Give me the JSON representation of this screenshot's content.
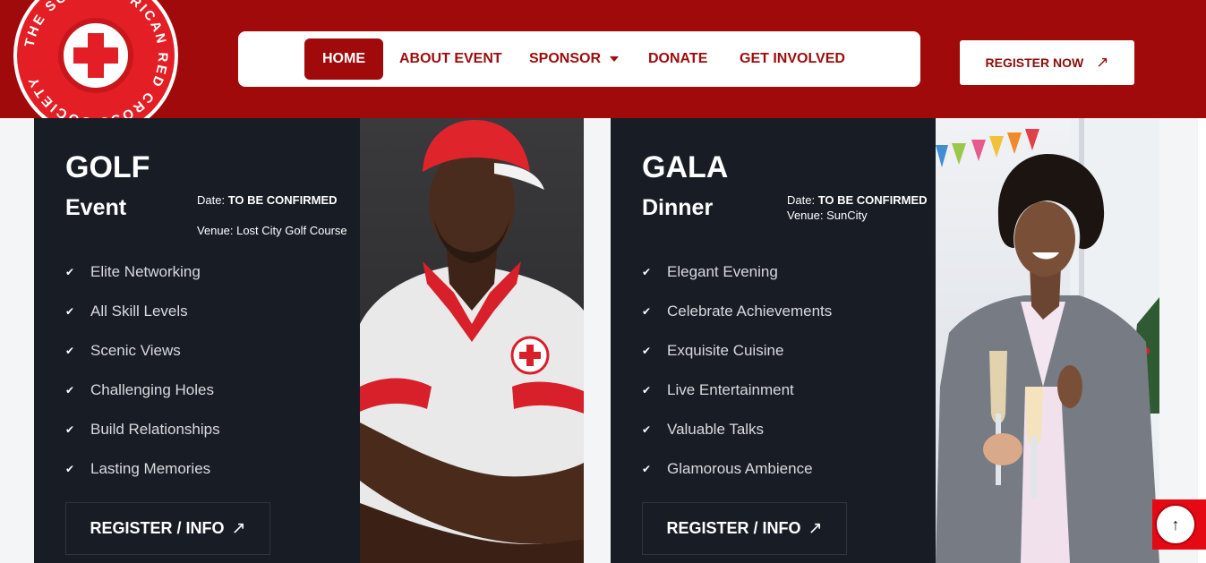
{
  "logo": {
    "text": "THE SOUTH AFRICAN RED CROSS SOCIETY"
  },
  "nav": {
    "items": [
      {
        "label": "HOME",
        "active": true
      },
      {
        "label": "ABOUT EVENT"
      },
      {
        "label": "SPONSOR"
      },
      {
        "label": "DONATE"
      },
      {
        "label": "GET INVOLVED"
      }
    ]
  },
  "header": {
    "register_label": "REGISTER NOW",
    "register_icon": "arrow-up-right-icon"
  },
  "golf": {
    "title": "GOLF",
    "subtitle": "Event",
    "date_label": "Date: ",
    "date_value": "TO BE CONFIRMED",
    "venue": "Venue: Lost City Golf Course",
    "features": [
      "Elite Networking",
      "All Skill Levels",
      "Scenic Views",
      "Challenging Holes",
      "Build Relationships",
      "Lasting Memories"
    ],
    "button_label": "REGISTER / INFO",
    "photo": "golfer-portrait-image"
  },
  "gala": {
    "title": "GALA",
    "subtitle": "Dinner",
    "date_label": "Date: ",
    "date_value": "TO BE CONFIRMED",
    "venue": "Venue: SunCity",
    "features": [
      "Elegant Evening",
      "Celebrate Achievements",
      "Exquisite Cuisine",
      "Live Entertainment",
      "Valuable Talks",
      "Glamorous Ambience"
    ],
    "button_label": "REGISTER / INFO",
    "photo": "gala-guest-toast-image"
  },
  "colors": {
    "brand_red": "#a10a0a",
    "card_bg": "#181c25",
    "accent_red": "#e31e24"
  }
}
